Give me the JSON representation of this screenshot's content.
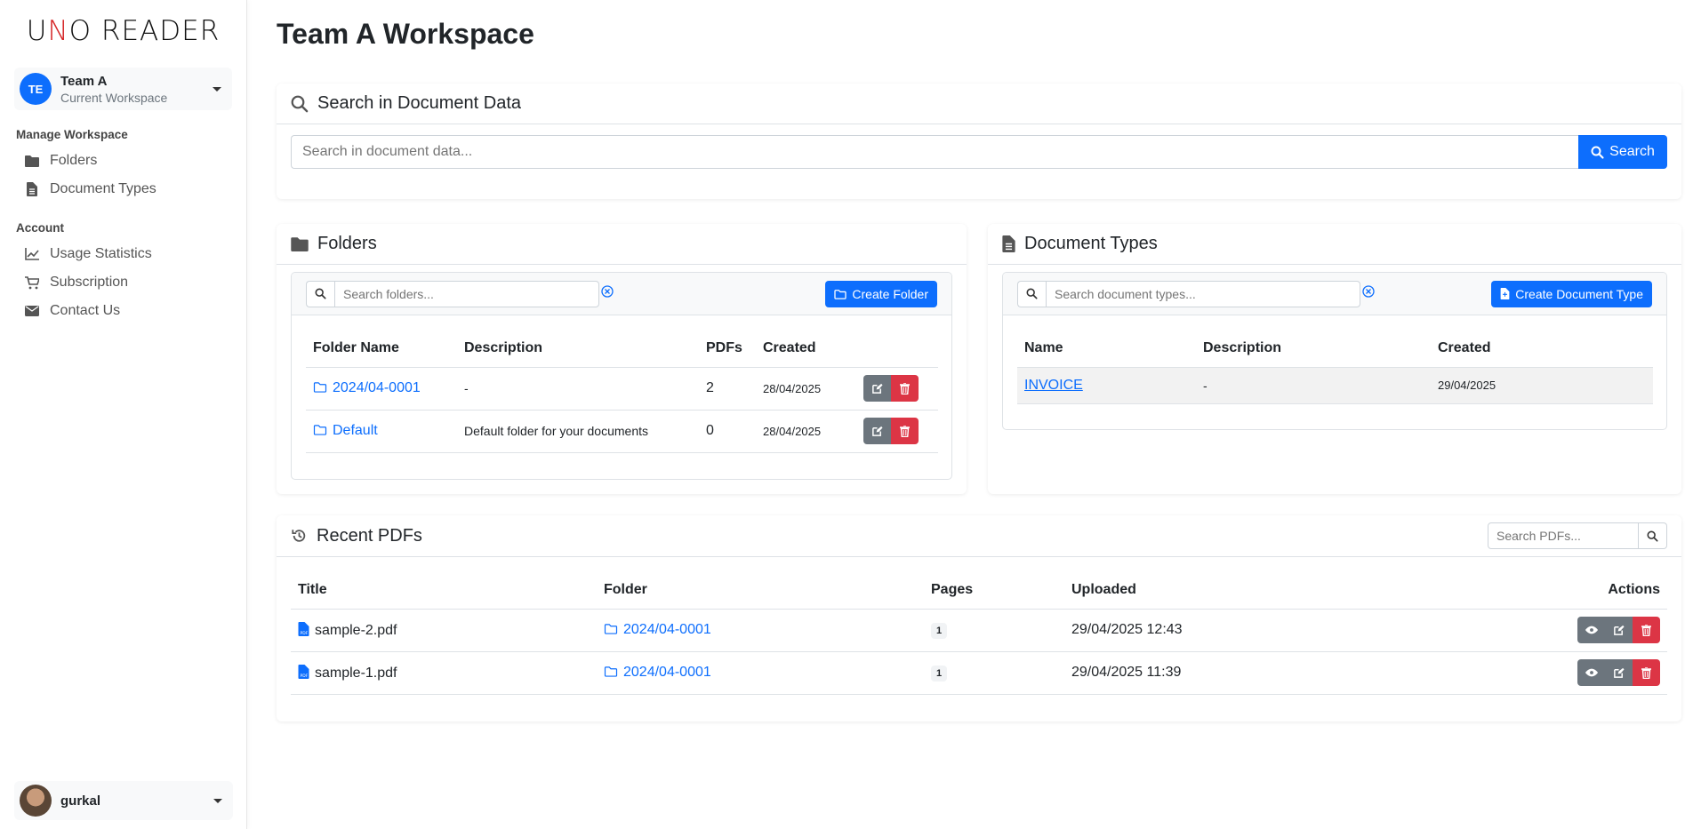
{
  "app": {
    "logo_prefix": "U",
    "logo_accent": "N",
    "logo_suffix": "O READER"
  },
  "workspace": {
    "avatar_initials": "TE",
    "name": "Team A",
    "subtitle": "Current Workspace"
  },
  "sidebar": {
    "manage_heading": "Manage Workspace",
    "manage_items": [
      {
        "label": "Folders",
        "icon": "folder-icon"
      },
      {
        "label": "Document Types",
        "icon": "file-icon"
      }
    ],
    "account_heading": "Account",
    "account_items": [
      {
        "label": "Usage Statistics",
        "icon": "chart-line-icon"
      },
      {
        "label": "Subscription",
        "icon": "cart-icon"
      },
      {
        "label": "Contact Us",
        "icon": "envelope-icon"
      }
    ]
  },
  "user": {
    "name": "gurkal"
  },
  "page": {
    "title": "Team A Workspace"
  },
  "doc_search": {
    "title": "Search in Document Data",
    "placeholder": "Search in document data...",
    "button": "Search"
  },
  "folders": {
    "title": "Folders",
    "search_placeholder": "Search folders...",
    "create_button": "Create Folder",
    "columns": [
      "Folder Name",
      "Description",
      "PDFs",
      "Created"
    ],
    "rows": [
      {
        "name": "2024/04-0001",
        "description": "-",
        "pdfs": "2",
        "created": "28/04/2025"
      },
      {
        "name": "Default",
        "description": "Default folder for your documents",
        "pdfs": "0",
        "created": "28/04/2025"
      }
    ]
  },
  "doc_types": {
    "title": "Document Types",
    "search_placeholder": "Search document types...",
    "create_button": "Create Document Type",
    "columns": [
      "Name",
      "Description",
      "Created"
    ],
    "rows": [
      {
        "name": "INVOICE",
        "description": "-",
        "created": "29/04/2025"
      }
    ]
  },
  "recent": {
    "title": "Recent PDFs",
    "search_placeholder": "Search PDFs...",
    "columns": [
      "Title",
      "Folder",
      "Pages",
      "Uploaded",
      "Actions"
    ],
    "rows": [
      {
        "title": "sample-2.pdf",
        "folder": "2024/04-0001",
        "pages": "1",
        "uploaded": "29/04/2025 12:43"
      },
      {
        "title": "sample-1.pdf",
        "folder": "2024/04-0001",
        "pages": "1",
        "uploaded": "29/04/2025 11:39"
      }
    ]
  },
  "colors": {
    "primary": "#0d6efd",
    "danger": "#dc3545",
    "secondary": "#6c757d"
  }
}
